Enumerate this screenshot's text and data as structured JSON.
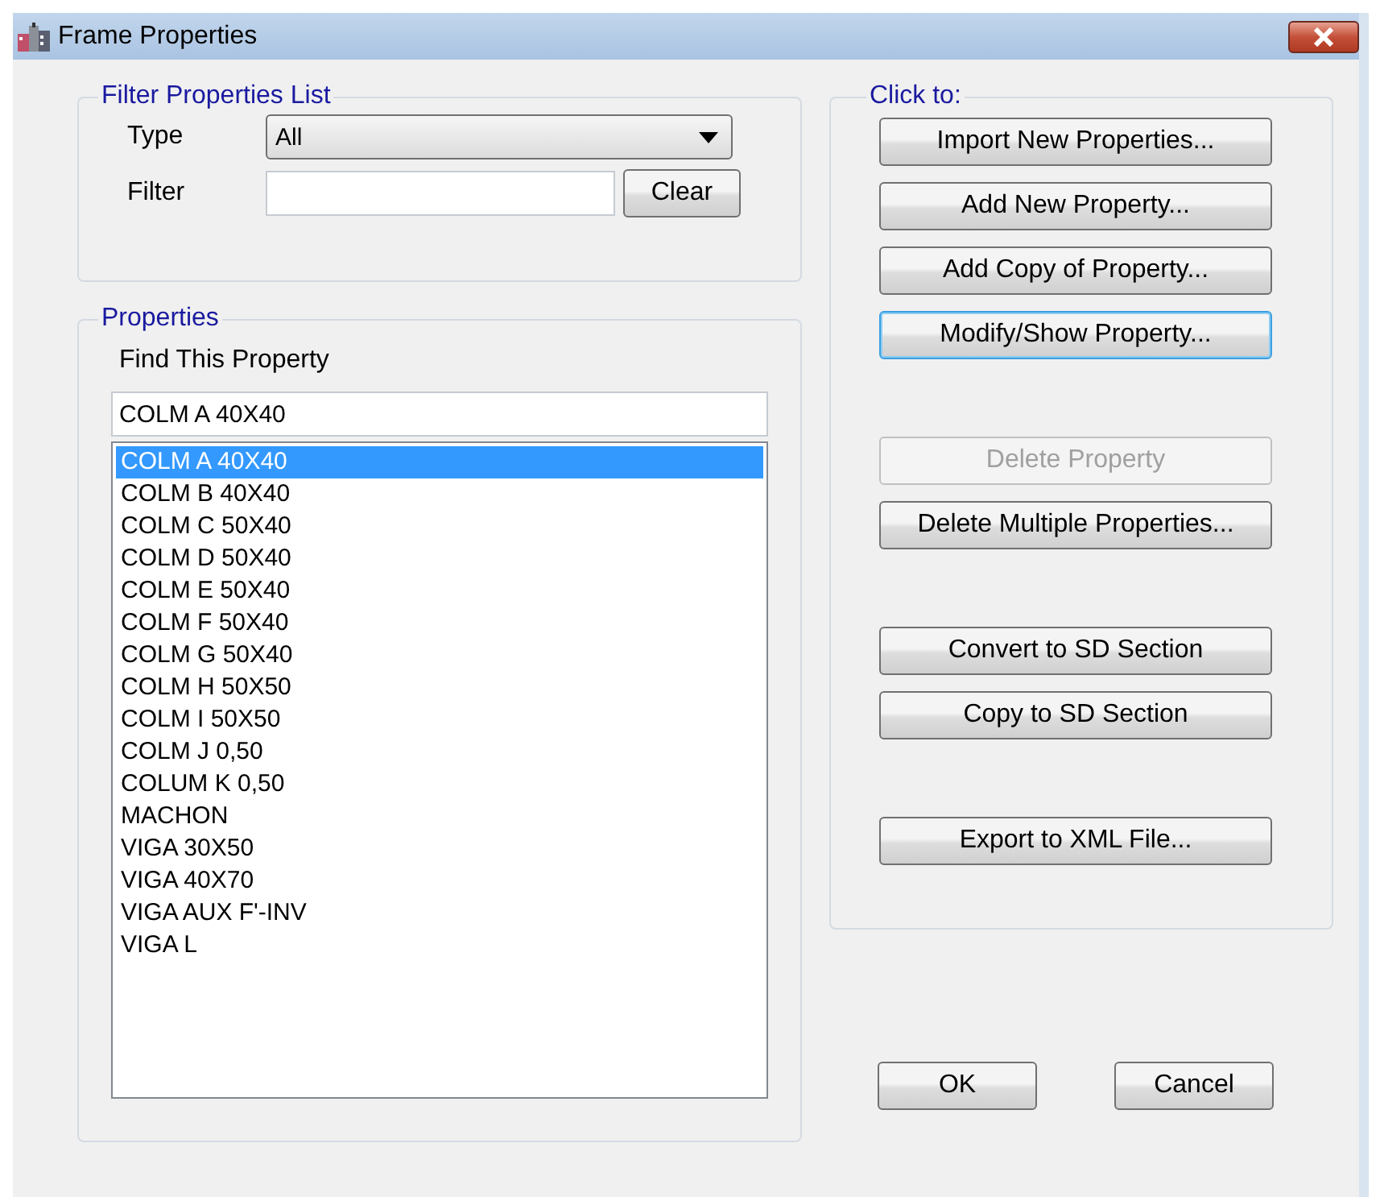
{
  "window": {
    "title": "Frame Properties"
  },
  "filter_group": {
    "title": "Filter Properties List",
    "type_label": "Type",
    "type_value": "All",
    "filter_label": "Filter",
    "clear_button": "Clear"
  },
  "properties_group": {
    "title": "Properties",
    "find_label": "Find This Property",
    "find_value": "COLM A 40X40",
    "items": [
      {
        "label": "COLM A 40X40",
        "selected": true
      },
      {
        "label": "COLM B 40X40",
        "selected": false
      },
      {
        "label": "COLM C 50X40",
        "selected": false
      },
      {
        "label": "COLM D 50X40",
        "selected": false
      },
      {
        "label": "COLM E 50X40",
        "selected": false
      },
      {
        "label": "COLM F 50X40",
        "selected": false
      },
      {
        "label": "COLM G 50X40",
        "selected": false
      },
      {
        "label": "COLM H 50X50",
        "selected": false
      },
      {
        "label": "COLM I 50X50",
        "selected": false
      },
      {
        "label": "COLM J 0,50",
        "selected": false
      },
      {
        "label": "COLUM K 0,50",
        "selected": false
      },
      {
        "label": "MACHON",
        "selected": false
      },
      {
        "label": "VIGA 30X50",
        "selected": false
      },
      {
        "label": "VIGA 40X70",
        "selected": false
      },
      {
        "label": "VIGA AUX F'-INV",
        "selected": false
      },
      {
        "label": "VIGA L",
        "selected": false
      }
    ]
  },
  "actions_group": {
    "title": "Click to:",
    "button_groups": [
      [
        {
          "label": "Import New Properties...",
          "disabled": false,
          "focused": false
        },
        {
          "label": "Add New Property...",
          "disabled": false,
          "focused": false
        },
        {
          "label": "Add Copy of Property...",
          "disabled": false,
          "focused": false
        },
        {
          "label": "Modify/Show Property...",
          "disabled": false,
          "focused": true
        }
      ],
      [
        {
          "label": "Delete Property",
          "disabled": true,
          "focused": false
        },
        {
          "label": "Delete Multiple Properties...",
          "disabled": false,
          "focused": false
        }
      ],
      [
        {
          "label": "Convert to SD Section",
          "disabled": false,
          "focused": false
        },
        {
          "label": "Copy to SD Section",
          "disabled": false,
          "focused": false
        }
      ],
      [
        {
          "label": "Export to XML File...",
          "disabled": false,
          "focused": false
        }
      ]
    ]
  },
  "dialog_buttons": [
    "OK",
    "Cancel"
  ]
}
